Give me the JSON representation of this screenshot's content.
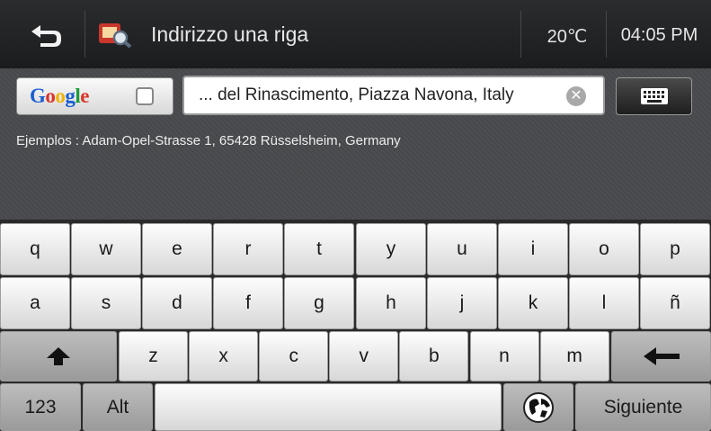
{
  "header": {
    "title": "Indirizzo una riga",
    "temperature": "20℃",
    "time": "04:05 PM"
  },
  "search": {
    "google_label": [
      "G",
      "o",
      "o",
      "g",
      "l",
      "e"
    ],
    "query": "... del Rinascimento, Piazza Navona, Italy"
  },
  "examples": "Ejemplos : Adam-Opel-Strasse 1, 65428 Rüsselsheim, Germany",
  "colors": {
    "google_letters": [
      "#1a5fd1",
      "#d8352a",
      "#f0b400",
      "#1a5fd1",
      "#1f9b3c",
      "#d8352a"
    ]
  },
  "keyboard": {
    "row1": [
      "q",
      "w",
      "e",
      "r",
      "t",
      "y",
      "u",
      "i",
      "o",
      "p"
    ],
    "row2": [
      "a",
      "s",
      "d",
      "f",
      "g",
      "h",
      "j",
      "k",
      "l",
      "ñ"
    ],
    "row3": [
      "z",
      "x",
      "c",
      "v",
      "b",
      "n",
      "m"
    ],
    "row4": {
      "numbers": "123",
      "alt": "Alt",
      "next": "Siguiente"
    },
    "icons": {
      "shift": "shift-up-arrow-icon",
      "backspace": "backspace-left-arrow-icon",
      "globe": "globe-icon"
    }
  }
}
